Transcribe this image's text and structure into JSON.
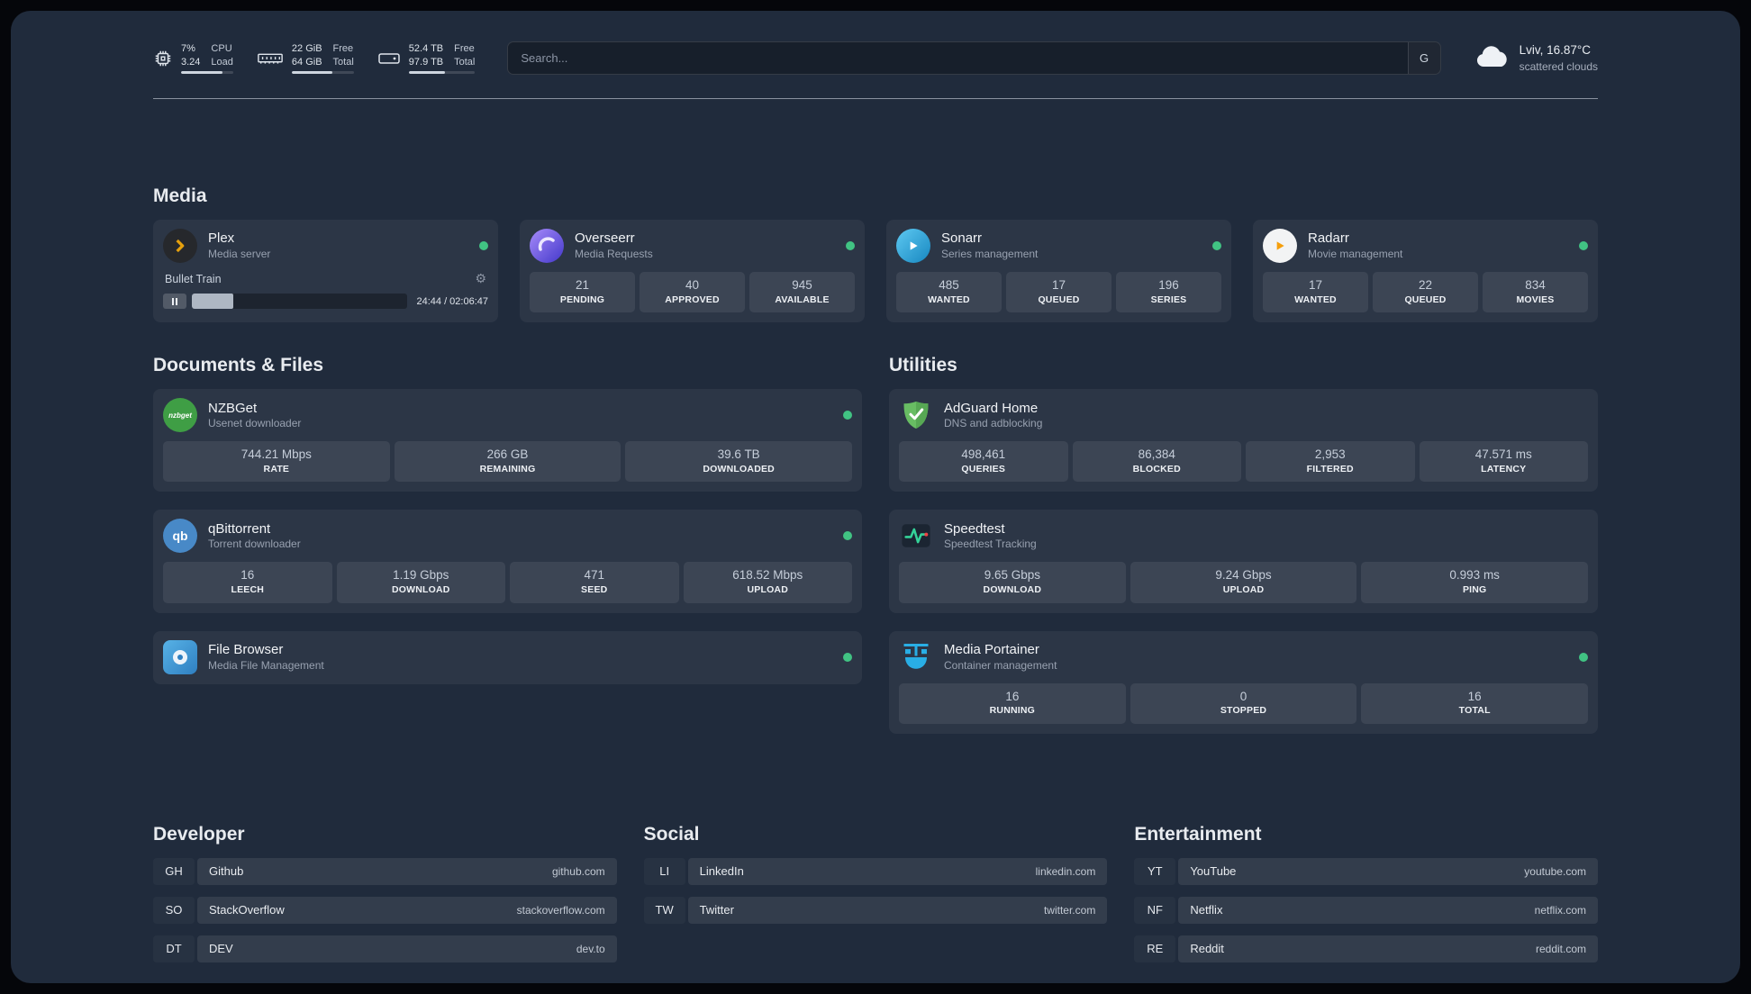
{
  "topbar": {
    "resources": [
      {
        "icon": "cpu-icon",
        "values": [
          "7%",
          "3.24"
        ],
        "labels": [
          "CPU",
          "Load"
        ],
        "progress": 80
      },
      {
        "icon": "memory-icon",
        "values": [
          "22 GiB",
          "64 GiB"
        ],
        "labels": [
          "Free",
          "Total"
        ],
        "progress": 65
      },
      {
        "icon": "disk-icon",
        "values": [
          "52.4 TB",
          "97.9 TB"
        ],
        "labels": [
          "Free",
          "Total"
        ],
        "progress": 55
      }
    ],
    "search": {
      "placeholder": "Search...",
      "button_label": "G"
    },
    "weather": {
      "location": "Lviv, 16.87°C",
      "condition": "scattered clouds"
    }
  },
  "media": {
    "title": "Media",
    "plex": {
      "name": "Plex",
      "desc": "Media server",
      "player": {
        "track": "Bullet Train",
        "time": "24:44 / 02:06:47",
        "progress": 19
      }
    },
    "overseerr": {
      "name": "Overseerr",
      "desc": "Media Requests",
      "stats": [
        {
          "value": "21",
          "label": "PENDING"
        },
        {
          "value": "40",
          "label": "APPROVED"
        },
        {
          "value": "945",
          "label": "AVAILABLE"
        }
      ]
    },
    "sonarr": {
      "name": "Sonarr",
      "desc": "Series management",
      "stats": [
        {
          "value": "485",
          "label": "WANTED"
        },
        {
          "value": "17",
          "label": "QUEUED"
        },
        {
          "value": "196",
          "label": "SERIES"
        }
      ]
    },
    "radarr": {
      "name": "Radarr",
      "desc": "Movie management",
      "stats": [
        {
          "value": "17",
          "label": "WANTED"
        },
        {
          "value": "22",
          "label": "QUEUED"
        },
        {
          "value": "834",
          "label": "MOVIES"
        }
      ]
    }
  },
  "documents": {
    "title": "Documents & Files",
    "nzbget": {
      "name": "NZBGet",
      "desc": "Usenet downloader",
      "icon_text": "nzbget",
      "stats": [
        {
          "value": "744.21 Mbps",
          "label": "RATE"
        },
        {
          "value": "266 GB",
          "label": "REMAINING"
        },
        {
          "value": "39.6 TB",
          "label": "DOWNLOADED"
        }
      ]
    },
    "qbittorrent": {
      "name": "qBittorrent",
      "desc": "Torrent downloader",
      "icon_text": "qb",
      "stats": [
        {
          "value": "16",
          "label": "LEECH"
        },
        {
          "value": "1.19 Gbps",
          "label": "DOWNLOAD"
        },
        {
          "value": "471",
          "label": "SEED"
        },
        {
          "value": "618.52 Mbps",
          "label": "UPLOAD"
        }
      ]
    },
    "filebrowser": {
      "name": "File Browser",
      "desc": "Media File Management"
    }
  },
  "utilities": {
    "title": "Utilities",
    "adguard": {
      "name": "AdGuard Home",
      "desc": "DNS and adblocking",
      "stats": [
        {
          "value": "498,461",
          "label": "QUERIES"
        },
        {
          "value": "86,384",
          "label": "BLOCKED"
        },
        {
          "value": "2,953",
          "label": "FILTERED"
        },
        {
          "value": "47.571 ms",
          "label": "LATENCY"
        }
      ]
    },
    "speedtest": {
      "name": "Speedtest",
      "desc": "Speedtest Tracking",
      "stats": [
        {
          "value": "9.65 Gbps",
          "label": "DOWNLOAD"
        },
        {
          "value": "9.24 Gbps",
          "label": "UPLOAD"
        },
        {
          "value": "0.993 ms",
          "label": "PING"
        }
      ]
    },
    "portainer": {
      "name": "Media Portainer",
      "desc": "Container management",
      "stats": [
        {
          "value": "16",
          "label": "RUNNING"
        },
        {
          "value": "0",
          "label": "STOPPED"
        },
        {
          "value": "16",
          "label": "TOTAL"
        }
      ]
    }
  },
  "bookmarks": [
    {
      "title": "Developer",
      "items": [
        {
          "abbr": "GH",
          "name": "Github",
          "url": "github.com"
        },
        {
          "abbr": "SO",
          "name": "StackOverflow",
          "url": "stackoverflow.com"
        },
        {
          "abbr": "DT",
          "name": "DEV",
          "url": "dev.to"
        }
      ]
    },
    {
      "title": "Social",
      "items": [
        {
          "abbr": "LI",
          "name": "LinkedIn",
          "url": "linkedin.com"
        },
        {
          "abbr": "TW",
          "name": "Twitter",
          "url": "twitter.com"
        }
      ]
    },
    {
      "title": "Entertainment",
      "items": [
        {
          "abbr": "YT",
          "name": "YouTube",
          "url": "youtube.com"
        },
        {
          "abbr": "NF",
          "name": "Netflix",
          "url": "netflix.com"
        },
        {
          "abbr": "RE",
          "name": "Reddit",
          "url": "reddit.com"
        }
      ]
    }
  ]
}
